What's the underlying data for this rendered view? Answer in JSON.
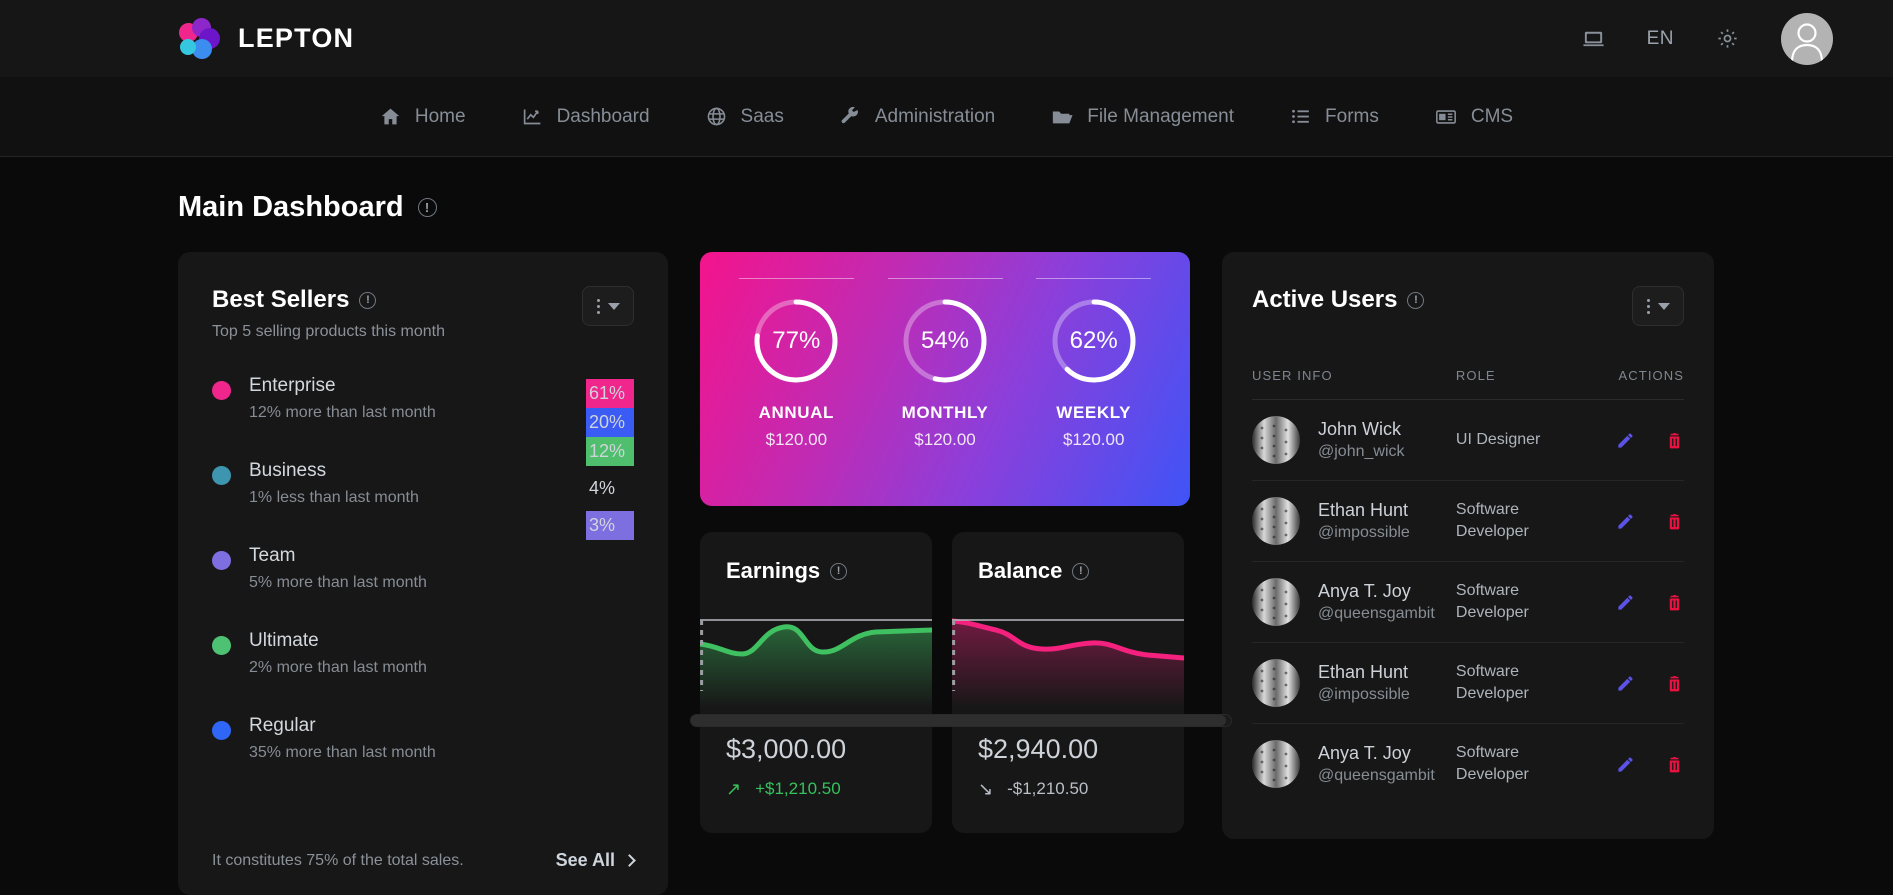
{
  "brand": {
    "name": "LEPTON",
    "logo_icon": "lepton-logo-icon"
  },
  "topbar": {
    "monitor_icon": "monitor-icon",
    "language": "EN",
    "settings_icon": "gear-icon",
    "avatar_icon": "user-avatar-icon"
  },
  "nav": {
    "items": [
      {
        "label": "Home",
        "icon": "home-icon"
      },
      {
        "label": "Dashboard",
        "icon": "chart-line-icon"
      },
      {
        "label": "Saas",
        "icon": "globe-icon"
      },
      {
        "label": "Administration",
        "icon": "wrench-icon"
      },
      {
        "label": "File Management",
        "icon": "folder-open-icon"
      },
      {
        "label": "Forms",
        "icon": "list-icon"
      },
      {
        "label": "CMS",
        "icon": "newspaper-icon"
      }
    ]
  },
  "page": {
    "title": "Main Dashboard",
    "info_icon": "info-exclamation-icon"
  },
  "best_sellers": {
    "title": "Best Sellers",
    "subtitle": "Top 5 selling products this month",
    "menu_icon": "kebab-menu-icon",
    "footer_text": "It constitutes 75% of the total sales.",
    "see_all": "See All",
    "items": [
      {
        "name": "Enterprise",
        "delta": "12% more than last month",
        "dot": "#f0268d",
        "pct": "61%",
        "badge_bg": "#f0268d"
      },
      {
        "name": "Business",
        "delta": "1% less than last month",
        "dot": "#3e95b0",
        "pct": "20%",
        "badge_bg": "#3b5bf5"
      },
      {
        "name": "Team",
        "delta": "5% more than last month",
        "dot": "#7d6fe0",
        "pct": "12%",
        "badge_bg": "#4fbf6e"
      },
      {
        "name": "Ultimate",
        "delta": "2% more than last month",
        "dot": "#4ec273",
        "pct": "4%",
        "badge_bg": "transparent"
      },
      {
        "name": "Regular",
        "delta": "35% more than last month",
        "dot": "#2f66f5",
        "pct": "3%",
        "badge_bg": "#7d6fe0"
      }
    ]
  },
  "stats_card": {
    "gradient_from": "#f4148c",
    "gradient_to": "#3f54f6",
    "rings": [
      {
        "percent": 77,
        "percent_label": "77%",
        "label": "ANNUAL",
        "amount": "$120.00"
      },
      {
        "percent": 54,
        "percent_label": "54%",
        "label": "MONTHLY",
        "amount": "$120.00"
      },
      {
        "percent": 62,
        "percent_label": "62%",
        "label": "WEEKLY",
        "amount": "$120.00"
      }
    ]
  },
  "mini_cards": [
    {
      "title": "Earnings",
      "info_icon": "info-exclamation-icon",
      "amount": "$3,000.00",
      "delta": "+$1,210.50",
      "delta_color": "#35c25c",
      "arrow": "↗",
      "line_color": "#3fc161",
      "chart_data": {
        "type": "area",
        "title": "Earnings",
        "x": [
          0,
          1,
          2,
          3,
          4,
          5,
          6,
          7
        ],
        "values": [
          42,
          38,
          33,
          34,
          52,
          58,
          47,
          44,
          56
        ],
        "ylim": [
          0,
          70
        ],
        "grid": false
      }
    },
    {
      "title": "Balance",
      "info_icon": "info-exclamation-icon",
      "amount": "$2,940.00",
      "delta": "-$1,210.50",
      "delta_color": "#b9bfc7",
      "arrow": "↘",
      "line_color": "#f5217f",
      "chart_data": {
        "type": "area",
        "title": "Balance",
        "x": [
          0,
          1,
          2,
          3,
          4,
          5,
          6,
          7
        ],
        "values": [
          62,
          60,
          54,
          45,
          43,
          46,
          47,
          41,
          38
        ],
        "ylim": [
          0,
          70
        ],
        "grid": false
      }
    }
  ],
  "active_users": {
    "title": "Active Users",
    "info_icon": "info-exclamation-icon",
    "menu_icon": "kebab-menu-icon",
    "columns": {
      "user_info": "USER INFO",
      "role": "ROLE",
      "actions": "ACTIONS"
    },
    "edit_icon": "pencil-icon",
    "delete_icon": "trash-icon",
    "rows": [
      {
        "name": "John Wick",
        "handle": "@john_wick",
        "role": "UI Designer"
      },
      {
        "name": "Ethan Hunt",
        "handle": "@impossible",
        "role": "Software Developer"
      },
      {
        "name": "Anya T. Joy",
        "handle": "@queensgambit",
        "role": "Software Developer"
      },
      {
        "name": "Ethan Hunt",
        "handle": "@impossible",
        "role": "Software Developer"
      },
      {
        "name": "Anya T. Joy",
        "handle": "@queensgambit",
        "role": "Software Developer"
      }
    ]
  }
}
